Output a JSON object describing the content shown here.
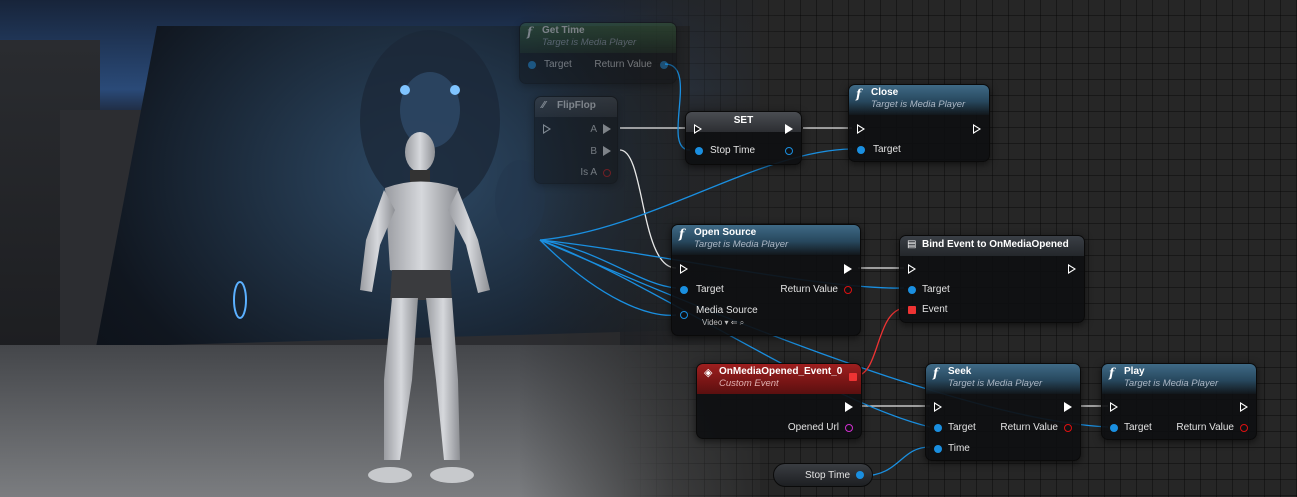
{
  "get_time": {
    "title": "Get Time",
    "subtitle": "Target is Media Player",
    "target": "Target",
    "return_value": "Return Value"
  },
  "flipflop": {
    "title": "FlipFlop",
    "a": "A",
    "b": "B",
    "is_a": "Is A"
  },
  "set": {
    "title": "SET",
    "stop_time": "Stop Time"
  },
  "close": {
    "title": "Close",
    "subtitle": "Target is Media Player",
    "target": "Target"
  },
  "open_source": {
    "title": "Open Source",
    "subtitle": "Target is Media Player",
    "target": "Target",
    "return_value": "Return Value",
    "media_source": "Media Source",
    "media_source_value": "Video"
  },
  "bind_event": {
    "title": "Bind Event to OnMediaOpened",
    "target": "Target",
    "event": "Event"
  },
  "custom_event": {
    "title": "OnMediaOpened_Event_0",
    "subtitle": "Custom Event",
    "opened_url": "Opened Url"
  },
  "seek": {
    "title": "Seek",
    "subtitle": "Target is Media Player",
    "target": "Target",
    "return_value": "Return Value",
    "time": "Time"
  },
  "play": {
    "title": "Play",
    "subtitle": "Target is Media Player",
    "target": "Target",
    "return_value": "Return Value"
  },
  "stop_time_var": {
    "label": "Stop Time"
  },
  "colors": {
    "exec": "#ffffff",
    "object": "#1a8fe0",
    "bool": "#d11111",
    "delegate": "#e33333",
    "string": "#d02fd0",
    "function_header": "#3f6a86",
    "event_header": "#9e1f1f"
  },
  "icons": {
    "function": "function-icon",
    "event": "event-diamond-icon",
    "bind": "bind-event-icon",
    "flipflop": "flipflop-icon"
  }
}
